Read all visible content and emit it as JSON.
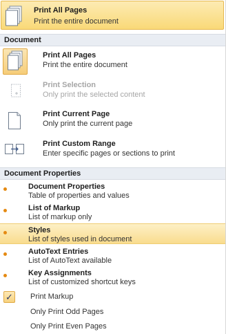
{
  "dropdown": {
    "title": "Print All Pages",
    "desc": "Print the entire document",
    "icon": "print-all-pages-icon"
  },
  "sections": {
    "document": "Document",
    "document_properties": "Document Properties"
  },
  "document_items": [
    {
      "title": "Print All Pages",
      "desc": "Print the entire document",
      "icon": "print-all-pages-icon",
      "selected": true,
      "disabled": false
    },
    {
      "title": "Print Selection",
      "desc": "Only print the selected content",
      "icon": "print-selection-icon",
      "selected": false,
      "disabled": true
    },
    {
      "title": "Print Current Page",
      "desc": "Only print the current page",
      "icon": "print-current-page-icon",
      "selected": false,
      "disabled": false
    },
    {
      "title": "Print Custom Range",
      "desc": "Enter specific pages or sections to print",
      "icon": "print-custom-range-icon",
      "selected": false,
      "disabled": false
    }
  ],
  "property_items": [
    {
      "title": "Document Properties",
      "desc": "Table of properties and values",
      "bullet": true,
      "highlighted": false
    },
    {
      "title": "List of Markup",
      "desc": "List of markup only",
      "bullet": true,
      "highlighted": false
    },
    {
      "title": "Styles",
      "desc": "List of styles used in document",
      "bullet": true,
      "highlighted": true
    },
    {
      "title": "AutoText Entries",
      "desc": "List of AutoText available",
      "bullet": true,
      "highlighted": false
    },
    {
      "title": "Key Assignments",
      "desc": "List of customized shortcut keys",
      "bullet": true,
      "highlighted": false
    }
  ],
  "options": [
    {
      "label": "Print Markup",
      "checked": true
    },
    {
      "label": "Only Print Odd Pages",
      "checked": false
    },
    {
      "label": "Only Print Even Pages",
      "checked": false
    }
  ],
  "check_glyph": "✓",
  "colors": {
    "selected_bg": "#f9d978",
    "selected_border": "#e6b84f",
    "bullet": "#e58a12",
    "section_bg": "#e9edf3"
  }
}
